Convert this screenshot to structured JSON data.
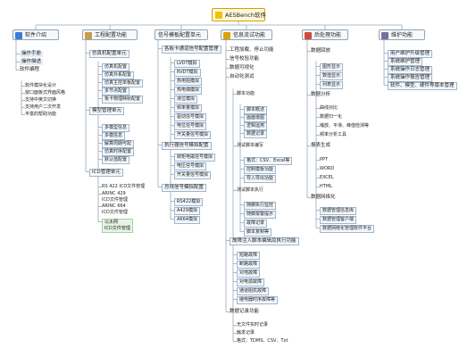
{
  "root": {
    "label": "AESBench软件"
  },
  "branches": [
    {
      "key": "b0",
      "label": "软件介绍",
      "icon": "info-icon",
      "icon_color": "#3b7dd8"
    },
    {
      "key": "b1",
      "label": "工程配置功能",
      "icon": "document-icon",
      "icon_color": "#c99b4f"
    },
    {
      "key": "b2",
      "label": "信号模板配置单元",
      "icon": "none",
      "icon_color": ""
    },
    {
      "key": "b3",
      "label": "信息流试功能",
      "icon": "gear-icon",
      "icon_color": "#e0a000"
    },
    {
      "key": "b4",
      "label": "后处理功能",
      "icon": "bar-chart-icon",
      "icon_color": "#d04a3a"
    },
    {
      "key": "b5",
      "label": "维护功能",
      "icon": "folder-icon",
      "icon_color": "#7a6f9a"
    }
  ],
  "nodes": [
    {
      "b": "b0",
      "label": "操作手册",
      "style": "blue"
    },
    {
      "b": "b0",
      "label": "操作描述",
      "style": "blue"
    },
    {
      "b": "b0",
      "label": "软件编程",
      "style": "plain"
    },
    {
      "b": "b0",
      "label": "软件模块化设计",
      "style": "plain"
    },
    {
      "b": "b0",
      "label": "窗口面板式界面风格",
      "style": "plain"
    },
    {
      "b": "b0",
      "label": "支持中英文切换",
      "style": "plain"
    },
    {
      "b": "b0",
      "label": "支持用户二次开发",
      "style": "plain"
    },
    {
      "b": "b0",
      "label": "丰富的帮助功能",
      "style": "plain"
    },
    {
      "b": "b1",
      "label": "仿真机配置单元",
      "style": "box"
    },
    {
      "b": "b1",
      "label": "仿真机配置",
      "style": "box"
    },
    {
      "b": "b1",
      "label": "仿真外系配置",
      "style": "box"
    },
    {
      "b": "b1",
      "label": "仿真主控单板配置",
      "style": "box"
    },
    {
      "b": "b1",
      "label": "多节点配置",
      "style": "box"
    },
    {
      "b": "b1",
      "label": "板卡物理映射配置",
      "style": "box"
    },
    {
      "b": "b1",
      "label": "模型管理单元",
      "style": "box"
    },
    {
      "b": "b1",
      "label": "多模型信息",
      "style": "box"
    },
    {
      "b": "b1",
      "label": "多模信息",
      "style": "box"
    },
    {
      "b": "b1",
      "label": "解算周期可配",
      "style": "box"
    },
    {
      "b": "b1",
      "label": "仿真时序配置",
      "style": "box"
    },
    {
      "b": "b1",
      "label": "默认值配置",
      "style": "box"
    },
    {
      "b": "b1",
      "label": "ICD管理单元",
      "style": "box"
    },
    {
      "b": "b1",
      "label": "RS 422 ICD文件管理",
      "style": "plain"
    },
    {
      "b": "b1",
      "label": "ARINC 429\nICD文件管理",
      "style": "plain"
    },
    {
      "b": "b1",
      "label": "ARINC 664\nICD文件管理",
      "style": "plain"
    },
    {
      "b": "b1",
      "label": "以太网\nICD文件管理",
      "style": "green"
    },
    {
      "b": "b2",
      "label": "各板卡通道信号配置管理",
      "style": "box"
    },
    {
      "b": "b2",
      "label": "LVDT模拟",
      "style": "box"
    },
    {
      "b": "b2",
      "label": "RVDT模拟",
      "style": "box"
    },
    {
      "b": "b2",
      "label": "热电阻模拟",
      "style": "box"
    },
    {
      "b": "b2",
      "label": "热电偶模拟",
      "style": "box"
    },
    {
      "b": "b2",
      "label": "液位模拟",
      "style": "box"
    },
    {
      "b": "b2",
      "label": "频率量模拟",
      "style": "box"
    },
    {
      "b": "b2",
      "label": "驱动信号模拟",
      "style": "box"
    },
    {
      "b": "b2",
      "label": "电位信号模拟",
      "style": "box"
    },
    {
      "b": "b2",
      "label": "开关量信号模拟",
      "style": "box"
    },
    {
      "b": "b2",
      "label": "执行器信号模拟配置",
      "style": "box"
    },
    {
      "b": "b2",
      "label": "转矩电磁信号模拟",
      "style": "box"
    },
    {
      "b": "b2",
      "label": "电压信号模拟",
      "style": "box"
    },
    {
      "b": "b2",
      "label": "开关量信号模拟",
      "style": "box"
    },
    {
      "b": "b2",
      "label": "总线信号模拟配置",
      "style": "box"
    },
    {
      "b": "b2",
      "label": "RS422模拟",
      "style": "box"
    },
    {
      "b": "b2",
      "label": "A429模拟",
      "style": "box"
    },
    {
      "b": "b2",
      "label": "A664模拟",
      "style": "box"
    },
    {
      "b": "b3",
      "label": "工程加载、停止功能",
      "style": "plain"
    },
    {
      "b": "b3",
      "label": "信号校验功能",
      "style": "plain"
    },
    {
      "b": "b3",
      "label": "数据可视化",
      "style": "plain"
    },
    {
      "b": "b3",
      "label": "自动化测试",
      "style": "plain"
    },
    {
      "b": "b3",
      "label": "脚本功能",
      "style": "plain"
    },
    {
      "b": "b3",
      "label": "脚本概述",
      "style": "box"
    },
    {
      "b": "b3",
      "label": "画面谱图",
      "style": "box"
    },
    {
      "b": "b3",
      "label": "逻辑运用",
      "style": "box"
    },
    {
      "b": "b3",
      "label": "数据记录",
      "style": "box"
    },
    {
      "b": "b3",
      "label": "测试脚本编写",
      "style": "plain"
    },
    {
      "b": "b3",
      "label": "格式：CSV、Excel等",
      "style": "box"
    },
    {
      "b": "b3",
      "label": "控制模板功能",
      "style": "box"
    },
    {
      "b": "b3",
      "label": "导入导出功能",
      "style": "box"
    },
    {
      "b": "b3",
      "label": "测试脚本执行",
      "style": "plain"
    },
    {
      "b": "b3",
      "label": "随脚执行监控",
      "style": "box"
    },
    {
      "b": "b3",
      "label": "随脚报警提示",
      "style": "box"
    },
    {
      "b": "b3",
      "label": "故障记录",
      "style": "box"
    },
    {
      "b": "b3",
      "label": "脚本复制等",
      "style": "box"
    },
    {
      "b": "b3",
      "label": "故障注入脚本编辑及执行功能",
      "style": "box"
    },
    {
      "b": "b3",
      "label": "短路故障",
      "style": "box"
    },
    {
      "b": "b3",
      "label": "断路故障",
      "style": "box"
    },
    {
      "b": "b3",
      "label": "对地故障",
      "style": "box"
    },
    {
      "b": "b3",
      "label": "对电源故障",
      "style": "box"
    },
    {
      "b": "b3",
      "label": "通道阻抗故障",
      "style": "box"
    },
    {
      "b": "b3",
      "label": "继电器时序故障等",
      "style": "box"
    },
    {
      "b": "b3",
      "label": "数据记录功能",
      "style": "plain"
    },
    {
      "b": "b3",
      "label": "无文件实时记录",
      "style": "plain"
    },
    {
      "b": "b3",
      "label": "触发记录",
      "style": "plain"
    },
    {
      "b": "b3",
      "label": "格式：TDMS、CSV、Txt",
      "style": "plain"
    },
    {
      "b": "b4",
      "label": "数据回放",
      "style": "plain"
    },
    {
      "b": "b4",
      "label": "图形显示",
      "style": "box"
    },
    {
      "b": "b4",
      "label": "数值显示",
      "style": "box"
    },
    {
      "b": "b4",
      "label": "列表显示",
      "style": "box"
    },
    {
      "b": "b4",
      "label": "数据分析",
      "style": "plain"
    },
    {
      "b": "b4",
      "label": "曲线对比",
      "style": "plain"
    },
    {
      "b": "b4",
      "label": "数据归一化",
      "style": "plain"
    },
    {
      "b": "b4",
      "label": "缩放、平滑、峰值检测等",
      "style": "plain"
    },
    {
      "b": "b4",
      "label": "频率分析工具",
      "style": "plain"
    },
    {
      "b": "b4",
      "label": "报表生成",
      "style": "plain"
    },
    {
      "b": "b4",
      "label": "PPT",
      "style": "plain"
    },
    {
      "b": "b4",
      "label": "WORD",
      "style": "plain"
    },
    {
      "b": "b4",
      "label": "EXCEL",
      "style": "plain"
    },
    {
      "b": "b4",
      "label": "HTML",
      "style": "plain"
    },
    {
      "b": "b4",
      "label": "数据网络化",
      "style": "plain"
    },
    {
      "b": "b4",
      "label": "数据管理信息库",
      "style": "box"
    },
    {
      "b": "b4",
      "label": "数据管理客户端",
      "style": "box"
    },
    {
      "b": "b4",
      "label": "数据网络化管理软件平台",
      "style": "box"
    },
    {
      "b": "b5",
      "label": "用户维护升级管理",
      "style": "box"
    },
    {
      "b": "b5",
      "label": "系统维护管理",
      "style": "box"
    },
    {
      "b": "b5",
      "label": "系统操作日志管理",
      "style": "box"
    },
    {
      "b": "b5",
      "label": "系统操作报告管理",
      "style": "box"
    },
    {
      "b": "b5",
      "label": "软件、模型、硬件等版本管理",
      "style": "box"
    }
  ]
}
